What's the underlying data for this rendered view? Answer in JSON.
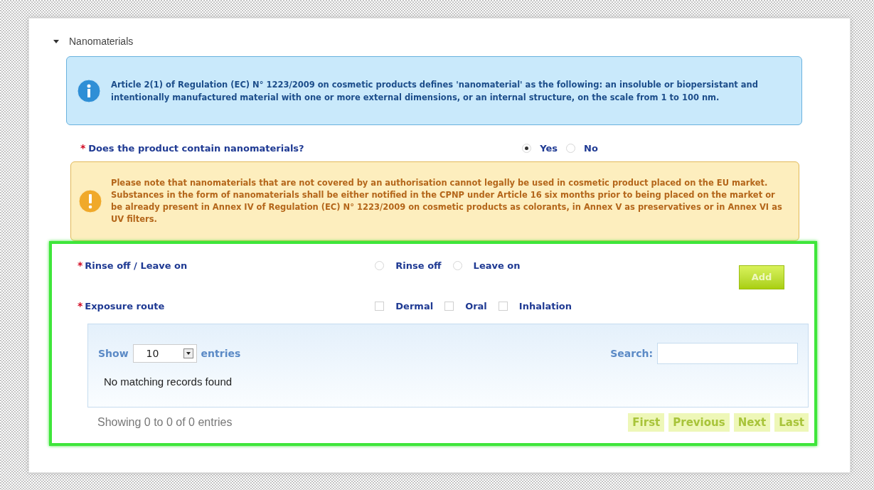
{
  "section": {
    "title": "Nanomaterials",
    "expanded": true
  },
  "info": {
    "text": "Article 2(1) of Regulation (EC) N° 1223/2009 on cosmetic products defines 'nanomaterial' as the following: an insoluble or biopersistant and intentionally manufactured material with one or more external dimensions, or an internal structure, on the scale from 1 to 100 nm."
  },
  "question": {
    "marker": "*",
    "label": "Does the product contain nanomaterials?",
    "options": [
      {
        "label": "Yes",
        "selected": true
      },
      {
        "label": "No",
        "selected": false
      }
    ]
  },
  "warning": {
    "paragraphs": [
      "Please note that nanomaterials that are not covered by an authorisation cannot legally be used in cosmetic product placed on the EU market.",
      "Substances in the form of nanomaterials shall be either notified in the CPNP under Article 16 six months prior to being placed on the market or be already present in Annex IV of Regulation (EC) N° 1223/2009 on cosmetic products as colorants, in Annex V as preservatives or in Annex VI as UV filters."
    ]
  },
  "form": {
    "fields": [
      {
        "marker": "*",
        "label": "Rinse off / Leave on",
        "kind": "radio",
        "options": [
          {
            "label": "Rinse off",
            "selected": false
          },
          {
            "label": "Leave on",
            "selected": false
          }
        ]
      },
      {
        "marker": "*",
        "label": "Exposure route",
        "kind": "checkbox",
        "options": [
          {
            "label": "Dermal",
            "checked": false
          },
          {
            "label": "Oral",
            "checked": false
          },
          {
            "label": "Inhalation",
            "checked": false
          }
        ]
      }
    ],
    "add_button": "Add"
  },
  "table": {
    "show_label": "Show",
    "page_size": "10",
    "entries_label": "entries",
    "search_label": "Search:",
    "empty_message": "No matching records found",
    "info": "Showing 0 to 0 of 0 entries",
    "pagination": [
      "First",
      "Previous",
      "Next",
      "Last"
    ]
  }
}
